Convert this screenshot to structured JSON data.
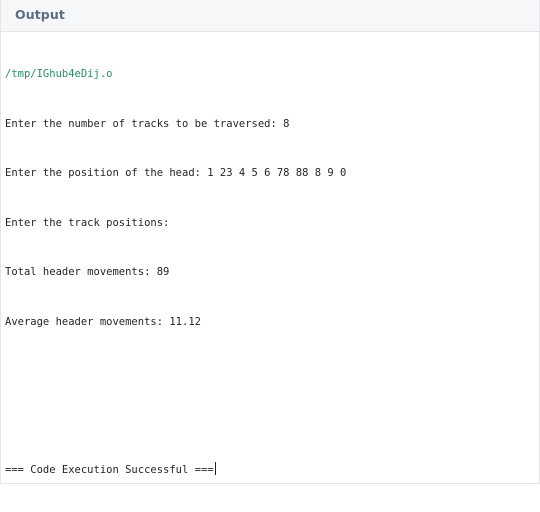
{
  "panel": {
    "title": "Output"
  },
  "console": {
    "file_path": "/tmp/IGhub4eDij.o",
    "lines": [
      "Enter the number of tracks to be traversed: 8",
      "Enter the position of the head: 1 23 4 5 6 78 88 8 9 0",
      "Enter the track positions:",
      "Total header movements: 89",
      "Average header movements: 11.12"
    ],
    "status": "=== Code Execution Successful ==="
  }
}
